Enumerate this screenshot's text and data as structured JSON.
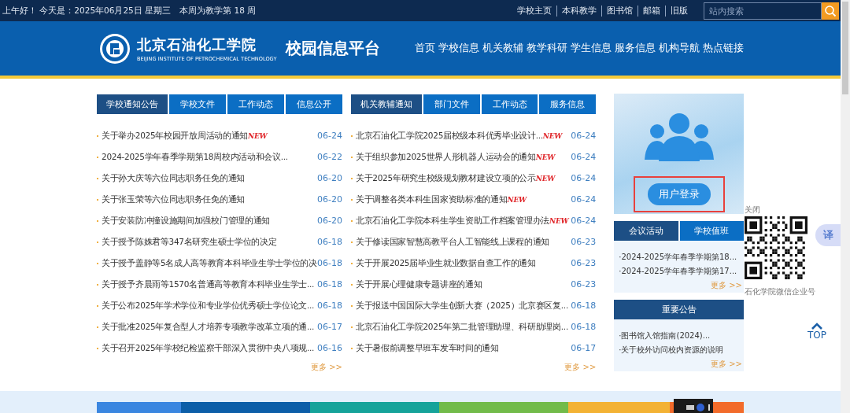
{
  "top_bar": {
    "greeting": "上午好！ 今天是：2025年06月25日 星期三　本周为教学第 18 周",
    "links": [
      "学校主页",
      "本科教学",
      "图书馆",
      "邮箱",
      "旧版"
    ],
    "search": {
      "placeholder": "站内搜索"
    }
  },
  "header": {
    "school_name": "北京石油化工学院",
    "school_name_en": "BEIJING INSTITUTE OF PETROCHEMICAL TECHNOLOGY",
    "platform_title": "校园信息平台",
    "nav": [
      "首页",
      "学校信息",
      "机关教辅",
      "教学科研",
      "学生信息",
      "服务信息",
      "机构导航",
      "热点链接"
    ]
  },
  "panels": [
    {
      "tabs": [
        {
          "label": "学校通知公告",
          "selected": true
        },
        {
          "label": "学校文件",
          "selected": false
        },
        {
          "label": "工作动态",
          "selected": false
        },
        {
          "label": "信息公开",
          "selected": false
        }
      ],
      "items": [
        {
          "title": "关于举办2025年校园开放周活动的通知",
          "badge": "NEW",
          "date": "06-24"
        },
        {
          "title": "2024-2025学年春季学期第18周校内活动和会议...",
          "date": "06-22"
        },
        {
          "title": "关于孙大庆等六位同志职务任免的通知",
          "date": "06-20"
        },
        {
          "title": "关于张玉荣等六位同志职务任免的通知",
          "date": "06-20"
        },
        {
          "title": "关于安装防冲撞设施期间加强校门管理的通知",
          "date": "06-20"
        },
        {
          "title": "关于授予陈姝君等347名研究生硕士学位的决定",
          "date": "06-18"
        },
        {
          "title": "关于授予盖静等5名成人高等教育本科毕业生学士学位的决",
          "date": "06-18"
        },
        {
          "title": "关于授予齐晨雨等1570名普通高等教育本科毕业生学士...",
          "date": "06-18"
        },
        {
          "title": "关于公布2025年学术学位和专业学位优秀硕士学位论文...",
          "date": "06-18"
        },
        {
          "title": "关于批准2025年复合型人才培养专项教学改革立项的通...",
          "date": "06-17"
        },
        {
          "title": "关于召开2025年学校纪检监察干部深入贯彻中央八项规...",
          "date": "06-16"
        }
      ],
      "more": "更多 >>"
    },
    {
      "tabs": [
        {
          "label": "机关教辅通知",
          "selected": true
        },
        {
          "label": "部门文件",
          "selected": false
        },
        {
          "label": "工作动态",
          "selected": false
        },
        {
          "label": "服务信息",
          "selected": false
        }
      ],
      "items": [
        {
          "title": "北京石油化工学院2025届校级本科优秀毕业设计...",
          "badge": "NEW",
          "date": "06-24"
        },
        {
          "title": "关于组织参加2025世界人形机器人运动会的通知",
          "badge": "NEW",
          "date": "06-24"
        },
        {
          "title": "关于2025年研究生校级规划教材建设立项的公示",
          "badge": "NEW",
          "date": "06-24"
        },
        {
          "title": "关于调整各类本科生国家资助标准的通知",
          "badge": "NEW",
          "date": "06-24"
        },
        {
          "title": "北京石油化工学院本科生学生资助工作档案管理办法",
          "badge": "NEW",
          "date": "06-24"
        },
        {
          "title": "关于修读国家智慧高教平台人工智能线上课程的通知",
          "date": "06-23"
        },
        {
          "title": "关于开展2025届毕业生就业数据自查工作的通知",
          "date": "06-23"
        },
        {
          "title": "关于开展心理健康专题讲座的通知",
          "date": "06-23"
        },
        {
          "title": "关于报送中国国际大学生创新大赛（2025）北京赛区复...",
          "date": "06-18"
        },
        {
          "title": "北京石油化工学院2025年第二批管理助理、科研助理岗...",
          "date": "06-18"
        },
        {
          "title": "关于暑假前调整早班车发车时间的通知",
          "date": "06-17"
        }
      ],
      "more": "更多 >>"
    }
  ],
  "login": {
    "button": "用户登录",
    "highlighted": true
  },
  "side_tabs": {
    "tabs": [
      {
        "label": "会议活动",
        "selected": true
      },
      {
        "label": "学校值班",
        "selected": false
      }
    ],
    "items": [
      "·2024-2025学年春季学期第18...",
      "·2024-2025学年春季学期第17..."
    ],
    "more": "更多 >>"
  },
  "notice": {
    "title": "重要公告",
    "items": [
      "·图书馆入馆指南(2024)...",
      "·关于校外访问校内资源的说明"
    ],
    "more": "更多 >>"
  },
  "qr": {
    "close": "关闭",
    "caption": "石化学院微信企业号"
  },
  "translate": "译",
  "back_to_top": "TOP"
}
